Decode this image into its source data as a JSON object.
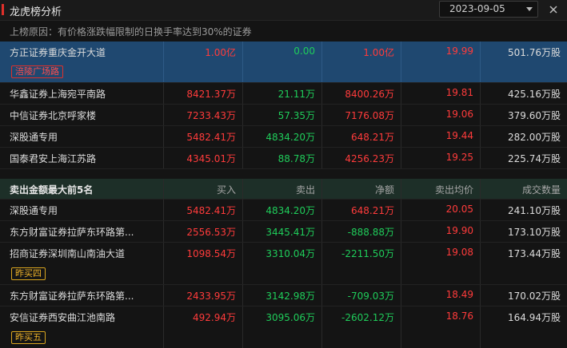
{
  "header": {
    "title": "龙虎榜分析",
    "date": "2023-09-05"
  },
  "reason": "上榜原因：有价格涨跌幅限制的日换手率达到30%的证券",
  "buy_rows": [
    {
      "name": "方正证券重庆金开大道",
      "buy": "1.00亿",
      "sell": "0.00",
      "net": "1.00亿",
      "avg": "19.99",
      "qty": "501.76万股",
      "badge": "涪陵广场路"
    },
    {
      "name": "华鑫证券上海宛平南路",
      "buy": "8421.37万",
      "sell": "21.11万",
      "net": "8400.26万",
      "avg": "19.81",
      "qty": "425.16万股"
    },
    {
      "name": "中信证券北京呼家楼",
      "buy": "7233.43万",
      "sell": "57.35万",
      "net": "7176.08万",
      "avg": "19.06",
      "qty": "379.60万股"
    },
    {
      "name": "深股通专用",
      "buy": "5482.41万",
      "sell": "4834.20万",
      "net": "648.21万",
      "avg": "19.44",
      "qty": "282.00万股"
    },
    {
      "name": "国泰君安上海江苏路",
      "buy": "4345.01万",
      "sell": "88.78万",
      "net": "4256.23万",
      "avg": "19.25",
      "qty": "225.74万股"
    }
  ],
  "sell_section": {
    "title": "卖出金额最大前5名",
    "columns": [
      "买入",
      "卖出",
      "净额",
      "卖出均价",
      "成交数量"
    ]
  },
  "sell_rows": [
    {
      "name": "深股通专用",
      "buy": "5482.41万",
      "sell": "4834.20万",
      "net": "648.21万",
      "avg": "20.05",
      "qty": "241.10万股"
    },
    {
      "name": "东方财富证券拉萨东环路第...",
      "buy": "2556.53万",
      "sell": "3445.41万",
      "net": "-888.88万",
      "avg": "19.90",
      "qty": "173.10万股"
    },
    {
      "name": "招商证券深圳南山南油大道",
      "buy": "1098.54万",
      "sell": "3310.04万",
      "net": "-2211.50万",
      "avg": "19.08",
      "qty": "173.44万股",
      "badge": "昨买四"
    },
    {
      "name": "东方财富证券拉萨东环路第...",
      "buy": "2433.95万",
      "sell": "3142.98万",
      "net": "-709.03万",
      "avg": "18.49",
      "qty": "170.02万股"
    },
    {
      "name": "安信证券西安曲江池南路",
      "buy": "492.94万",
      "sell": "3095.06万",
      "net": "-2602.12万",
      "avg": "18.76",
      "qty": "164.94万股",
      "badge": "昨买五"
    }
  ],
  "colors": {
    "accent": "#e0302a",
    "up": "#ff3b3b",
    "down": "#1fcc5a",
    "highlight": "#1f4870"
  }
}
